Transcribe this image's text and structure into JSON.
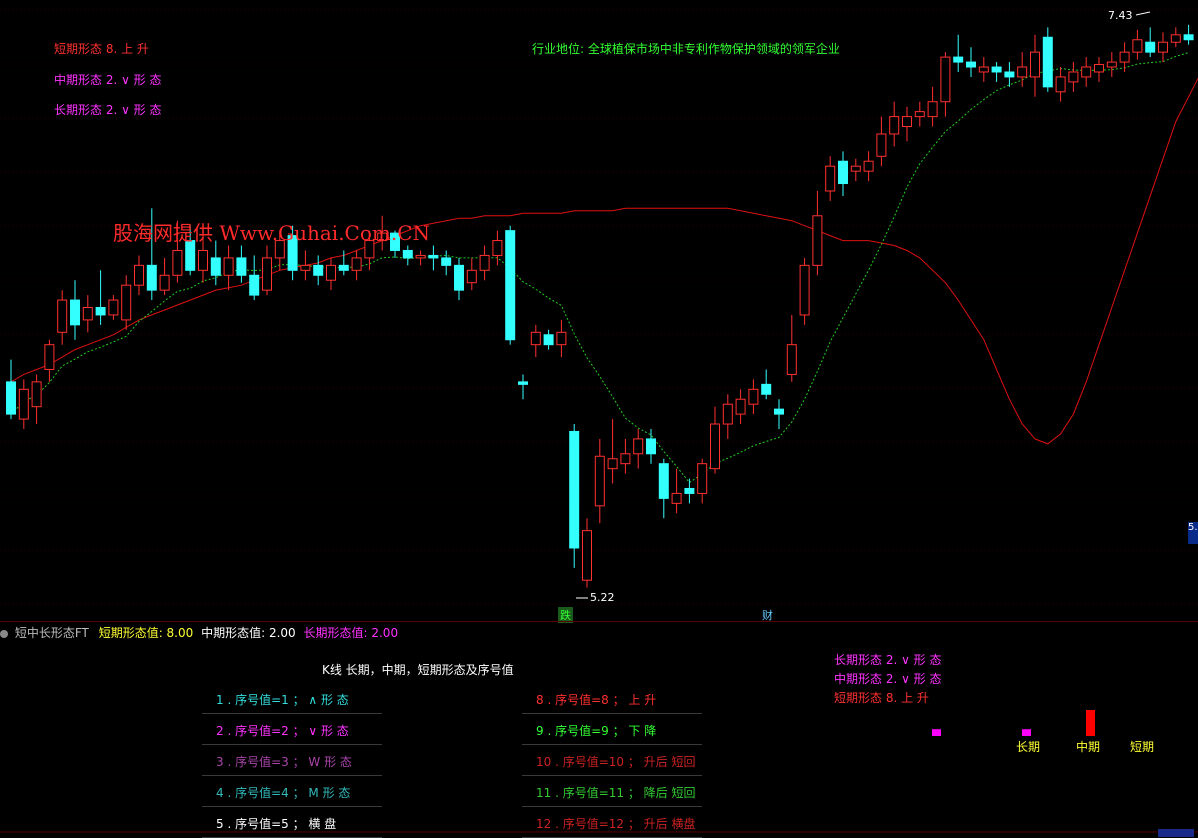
{
  "main_panel": {
    "short_form_label": "短期形态  8. 上 升",
    "mid_form_label": "中期形态 2. ∨ 形 态",
    "long_form_label": "长期形态 2. ∨ 形 态",
    "industry_note": "行业地位: 全球植保市场中非专利作物保护领域的领军企业",
    "watermark": "股海网提供 Www.Guhai.Com.CN",
    "high_marker": "7.43",
    "low_marker": "5.22",
    "event_die": "跌",
    "event_cai": "财",
    "right_axis_tag": "5."
  },
  "sub_panel": {
    "indicator_name": "短中长形态FT",
    "short_value_label": "短期形态值: 8.00",
    "mid_value_label": "中期形态值: 2.00",
    "long_value_label": "长期形态值: 2.00",
    "table_title": "K线 长期，中期，短期形态及序号值",
    "left_items": [
      {
        "text": "1 . 序号值=1 ； ∧ 形 态",
        "color": "#33dddd"
      },
      {
        "text": "2 . 序号值=2 ； ∨ 形 态",
        "color": "#ff33ff"
      },
      {
        "text": "3 . 序号值=3 ； W 形 态",
        "color": "#aa44aa"
      },
      {
        "text": "4 . 序号值=4 ； M 形 态",
        "color": "#33bbbb"
      },
      {
        "text": "5 . 序号值=5 ；  横 盘",
        "color": "#ffffff"
      }
    ],
    "right_items": [
      {
        "text": "8 . 序号值=8 ； 上 升",
        "color": "#ff3030"
      },
      {
        "text": "9 . 序号值=9 ； 下 降",
        "color": "#33ff33"
      },
      {
        "text": "10 . 序号值=10 ； 升后 短回",
        "color": "#cc2222"
      },
      {
        "text": "11 . 序号值=11 ； 降后 短回",
        "color": "#33cc33"
      },
      {
        "text": "12 . 序号值=12 ； 升后 横盘",
        "color": "#cc2222"
      }
    ],
    "summary_long": "长期形态 2. ∨ 形 态",
    "summary_mid": "中期形态 2. ∨ 形 态",
    "summary_short": "短期形态  8. 上 升",
    "bar_labels": [
      "长期",
      "中期",
      "短期"
    ],
    "bar_values": [
      2,
      2,
      8
    ]
  },
  "chart_data": {
    "type": "candlestick",
    "colors": {
      "up": "#ff3030",
      "down": "#33ffff",
      "ma_long": "#dd1111",
      "ma_mid": "#22cc22"
    },
    "candles": [
      {
        "o": 6.05,
        "c": 5.92,
        "h": 6.14,
        "l": 5.9
      },
      {
        "o": 5.9,
        "c": 6.02,
        "h": 6.06,
        "l": 5.86
      },
      {
        "o": 5.95,
        "c": 6.05,
        "h": 6.08,
        "l": 5.88
      },
      {
        "o": 6.1,
        "c": 6.2,
        "h": 6.22,
        "l": 6.05
      },
      {
        "o": 6.25,
        "c": 6.38,
        "h": 6.42,
        "l": 6.2
      },
      {
        "o": 6.38,
        "c": 6.28,
        "h": 6.46,
        "l": 6.22
      },
      {
        "o": 6.3,
        "c": 6.35,
        "h": 6.4,
        "l": 6.25
      },
      {
        "o": 6.35,
        "c": 6.32,
        "h": 6.5,
        "l": 6.28
      },
      {
        "o": 6.32,
        "c": 6.38,
        "h": 6.4,
        "l": 6.3
      },
      {
        "o": 6.3,
        "c": 6.44,
        "h": 6.48,
        "l": 6.26
      },
      {
        "o": 6.44,
        "c": 6.52,
        "h": 6.56,
        "l": 6.4
      },
      {
        "o": 6.52,
        "c": 6.42,
        "h": 6.75,
        "l": 6.38
      },
      {
        "o": 6.42,
        "c": 6.48,
        "h": 6.55,
        "l": 6.4
      },
      {
        "o": 6.48,
        "c": 6.58,
        "h": 6.7,
        "l": 6.45
      },
      {
        "o": 6.62,
        "c": 6.5,
        "h": 6.68,
        "l": 6.48
      },
      {
        "o": 6.5,
        "c": 6.58,
        "h": 6.66,
        "l": 6.45
      },
      {
        "o": 6.55,
        "c": 6.48,
        "h": 6.62,
        "l": 6.44
      },
      {
        "o": 6.48,
        "c": 6.55,
        "h": 6.6,
        "l": 6.42
      },
      {
        "o": 6.55,
        "c": 6.48,
        "h": 6.6,
        "l": 6.45
      },
      {
        "o": 6.48,
        "c": 6.4,
        "h": 6.56,
        "l": 6.38
      },
      {
        "o": 6.42,
        "c": 6.55,
        "h": 6.6,
        "l": 6.4
      },
      {
        "o": 6.55,
        "c": 6.62,
        "h": 6.66,
        "l": 6.5
      },
      {
        "o": 6.64,
        "c": 6.5,
        "h": 6.68,
        "l": 6.46
      },
      {
        "o": 6.5,
        "c": 6.52,
        "h": 6.58,
        "l": 6.46
      },
      {
        "o": 6.52,
        "c": 6.48,
        "h": 6.56,
        "l": 6.44
      },
      {
        "o": 6.46,
        "c": 6.52,
        "h": 6.55,
        "l": 6.42
      },
      {
        "o": 6.52,
        "c": 6.5,
        "h": 6.58,
        "l": 6.48
      },
      {
        "o": 6.5,
        "c": 6.55,
        "h": 6.58,
        "l": 6.46
      },
      {
        "o": 6.55,
        "c": 6.62,
        "h": 6.66,
        "l": 6.5
      },
      {
        "o": 6.62,
        "c": 6.65,
        "h": 6.72,
        "l": 6.58
      },
      {
        "o": 6.65,
        "c": 6.58,
        "h": 6.66,
        "l": 6.55
      },
      {
        "o": 6.58,
        "c": 6.55,
        "h": 6.6,
        "l": 6.52
      },
      {
        "o": 6.55,
        "c": 6.56,
        "h": 6.58,
        "l": 6.52
      },
      {
        "o": 6.56,
        "c": 6.55,
        "h": 6.6,
        "l": 6.5
      },
      {
        "o": 6.55,
        "c": 6.52,
        "h": 6.58,
        "l": 6.48
      },
      {
        "o": 6.52,
        "c": 6.42,
        "h": 6.55,
        "l": 6.38
      },
      {
        "o": 6.45,
        "c": 6.5,
        "h": 6.55,
        "l": 6.42
      },
      {
        "o": 6.5,
        "c": 6.56,
        "h": 6.6,
        "l": 6.46
      },
      {
        "o": 6.56,
        "c": 6.62,
        "h": 6.66,
        "l": 6.52
      },
      {
        "o": 6.66,
        "c": 6.22,
        "h": 6.68,
        "l": 6.2
      },
      {
        "o": 6.05,
        "c": 6.04,
        "h": 6.08,
        "l": 5.98
      },
      {
        "o": 6.2,
        "c": 6.25,
        "h": 6.28,
        "l": 6.15
      },
      {
        "o": 6.24,
        "c": 6.2,
        "h": 6.26,
        "l": 6.18
      },
      {
        "o": 6.2,
        "c": 6.25,
        "h": 6.3,
        "l": 6.15
      },
      {
        "o": 5.85,
        "c": 5.38,
        "h": 5.88,
        "l": 5.3
      },
      {
        "o": 5.25,
        "c": 5.45,
        "h": 5.5,
        "l": 5.22
      },
      {
        "o": 5.55,
        "c": 5.75,
        "h": 5.82,
        "l": 5.48
      },
      {
        "o": 5.7,
        "c": 5.74,
        "h": 5.9,
        "l": 5.64
      },
      {
        "o": 5.72,
        "c": 5.76,
        "h": 5.82,
        "l": 5.68
      },
      {
        "o": 5.76,
        "c": 5.82,
        "h": 5.86,
        "l": 5.7
      },
      {
        "o": 5.82,
        "c": 5.76,
        "h": 5.86,
        "l": 5.72
      },
      {
        "o": 5.72,
        "c": 5.58,
        "h": 5.74,
        "l": 5.5
      },
      {
        "o": 5.56,
        "c": 5.6,
        "h": 5.7,
        "l": 5.52
      },
      {
        "o": 5.62,
        "c": 5.6,
        "h": 5.66,
        "l": 5.56
      },
      {
        "o": 5.6,
        "c": 5.72,
        "h": 5.74,
        "l": 5.56
      },
      {
        "o": 5.7,
        "c": 5.88,
        "h": 5.95,
        "l": 5.68
      },
      {
        "o": 5.88,
        "c": 5.96,
        "h": 6.0,
        "l": 5.82
      },
      {
        "o": 5.92,
        "c": 5.98,
        "h": 6.02,
        "l": 5.88
      },
      {
        "o": 5.96,
        "c": 6.02,
        "h": 6.06,
        "l": 5.92
      },
      {
        "o": 6.04,
        "c": 6.0,
        "h": 6.1,
        "l": 5.98
      },
      {
        "o": 5.94,
        "c": 5.92,
        "h": 5.98,
        "l": 5.86
      },
      {
        "o": 6.08,
        "c": 6.2,
        "h": 6.32,
        "l": 6.05
      },
      {
        "o": 6.32,
        "c": 6.52,
        "h": 6.55,
        "l": 6.28
      },
      {
        "o": 6.52,
        "c": 6.72,
        "h": 6.82,
        "l": 6.48
      },
      {
        "o": 6.82,
        "c": 6.92,
        "h": 6.96,
        "l": 6.78
      },
      {
        "o": 6.94,
        "c": 6.85,
        "h": 6.98,
        "l": 6.8
      },
      {
        "o": 6.9,
        "c": 6.92,
        "h": 6.95,
        "l": 6.86
      },
      {
        "o": 6.9,
        "c": 6.94,
        "h": 6.98,
        "l": 6.86
      },
      {
        "o": 6.96,
        "c": 7.05,
        "h": 7.12,
        "l": 6.92
      },
      {
        "o": 7.05,
        "c": 7.12,
        "h": 7.18,
        "l": 7.0
      },
      {
        "o": 7.08,
        "c": 7.12,
        "h": 7.16,
        "l": 7.02
      },
      {
        "o": 7.12,
        "c": 7.14,
        "h": 7.18,
        "l": 7.08
      },
      {
        "o": 7.12,
        "c": 7.18,
        "h": 7.24,
        "l": 7.08
      },
      {
        "o": 7.18,
        "c": 7.36,
        "h": 7.38,
        "l": 7.12
      },
      {
        "o": 7.36,
        "c": 7.34,
        "h": 7.45,
        "l": 7.3
      },
      {
        "o": 7.34,
        "c": 7.32,
        "h": 7.4,
        "l": 7.28
      },
      {
        "o": 7.3,
        "c": 7.32,
        "h": 7.36,
        "l": 7.26
      },
      {
        "o": 7.32,
        "c": 7.3,
        "h": 7.34,
        "l": 7.26
      },
      {
        "o": 7.3,
        "c": 7.28,
        "h": 7.34,
        "l": 7.24
      },
      {
        "o": 7.28,
        "c": 7.32,
        "h": 7.38,
        "l": 7.24
      },
      {
        "o": 7.28,
        "c": 7.38,
        "h": 7.45,
        "l": 7.2
      },
      {
        "o": 7.44,
        "c": 7.24,
        "h": 7.48,
        "l": 7.22
      },
      {
        "o": 7.22,
        "c": 7.28,
        "h": 7.32,
        "l": 7.18
      },
      {
        "o": 7.26,
        "c": 7.3,
        "h": 7.34,
        "l": 7.22
      },
      {
        "o": 7.28,
        "c": 7.32,
        "h": 7.36,
        "l": 7.24
      },
      {
        "o": 7.3,
        "c": 7.33,
        "h": 7.36,
        "l": 7.26
      },
      {
        "o": 7.32,
        "c": 7.34,
        "h": 7.38,
        "l": 7.28
      },
      {
        "o": 7.34,
        "c": 7.38,
        "h": 7.42,
        "l": 7.3
      },
      {
        "o": 7.38,
        "c": 7.43,
        "h": 7.47,
        "l": 7.35
      },
      {
        "o": 7.42,
        "c": 7.38,
        "h": 7.48,
        "l": 7.36
      },
      {
        "o": 7.38,
        "c": 7.42,
        "h": 7.46,
        "l": 7.34
      },
      {
        "o": 7.42,
        "c": 7.45,
        "h": 7.48,
        "l": 7.4
      },
      {
        "o": 7.45,
        "c": 7.43,
        "h": 7.49,
        "l": 7.41
      }
    ],
    "ma_long": [
      6.05,
      6.08,
      6.1,
      6.12,
      6.15,
      6.18,
      6.2,
      6.22,
      6.24,
      6.27,
      6.3,
      6.32,
      6.34,
      6.36,
      6.38,
      6.4,
      6.42,
      6.43,
      6.44,
      6.46,
      6.48,
      6.5,
      6.51,
      6.52,
      6.53,
      6.55,
      6.56,
      6.58,
      6.6,
      6.62,
      6.64,
      6.66,
      6.68,
      6.69,
      6.7,
      6.71,
      6.71,
      6.72,
      6.72,
      6.72,
      6.73,
      6.73,
      6.73,
      6.73,
      6.74,
      6.74,
      6.74,
      6.74,
      6.75,
      6.75,
      6.75,
      6.75,
      6.75,
      6.75,
      6.75,
      6.75,
      6.75,
      6.74,
      6.73,
      6.72,
      6.71,
      6.7,
      6.68,
      6.66,
      6.64,
      6.62,
      6.62,
      6.62,
      6.61,
      6.6,
      6.58,
      6.55,
      6.5,
      6.45,
      6.38,
      6.3,
      6.22,
      6.1,
      5.98,
      5.88,
      5.82,
      5.8,
      5.84,
      5.92,
      6.05,
      6.2,
      6.35,
      6.5,
      6.65,
      6.8,
      6.95,
      7.1,
      7.2,
      7.3
    ]
  }
}
